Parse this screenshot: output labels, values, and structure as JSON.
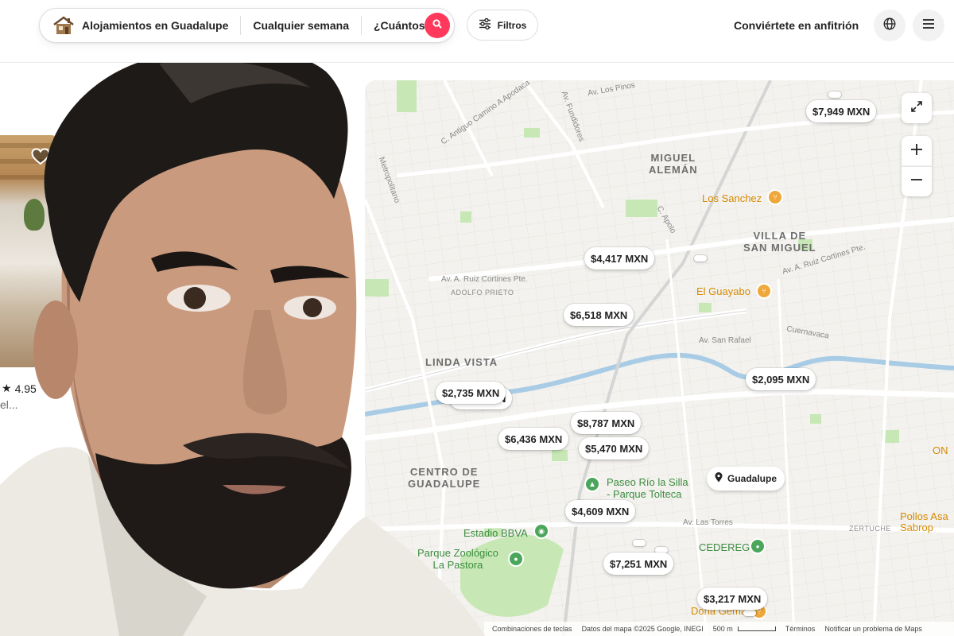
{
  "header": {
    "search": {
      "location": "Alojamientos en Guadalupe",
      "dates": "Cualquier semana",
      "guests": "¿Cuántos?"
    },
    "filters_label": "Filtros",
    "host_label": "Conviértete en anfitrión",
    "icons": {
      "logo": "house-icon",
      "search": "search-icon",
      "filters": "sliders-icon",
      "globe": "globe-icon",
      "menu": "hamburger-icon"
    }
  },
  "listing": {
    "rating": "4.95",
    "description": "el..."
  },
  "map": {
    "areas": [
      {
        "id": "miguel-aleman",
        "text": "MIGUEL\nALEMÁN"
      },
      {
        "id": "villa-de-san-miguel",
        "text": "VILLA DE\nSAN MIGUEL"
      },
      {
        "id": "linda-vista",
        "text": "LINDA VISTA"
      },
      {
        "id": "centro-de-guadalupe",
        "text": "CENTRO DE\nGUADALUPE"
      }
    ],
    "small_labels": {
      "adolfo_prieto": "ADOLFO PRIETO",
      "zertuche": "ZERTUCHE"
    },
    "streets": {
      "los_pinos": "Av. Los Pinos",
      "fundidores": "Av. Fundidores",
      "camino_apodaca": "C. Antiguo Camino A Apodaca",
      "ruiz_cortines_1": "Av. A. Ruiz Cortines Pte.",
      "ruiz_cortines_2": "Av. A. Ruiz Cortines Pte.",
      "apolo": "C. Apolo",
      "san_rafael": "Av. San Rafael",
      "cuernavaca": "Cuernavaca",
      "las_torres": "Av. Las Torres",
      "metropolitano": "Metropolitano"
    },
    "pois": {
      "los_sanchez": "Los Sanchez",
      "el_guayabo": "El Guayabo",
      "paseo_rio": "Paseo Río la Silla\n- Parque Tolteca",
      "estadio": "Estadio BBVA",
      "zoologico": "Parque Zoológico\nLa Pastora",
      "cedereg": "CEDEREG",
      "pollos": "Pollos Asa\nSabrop",
      "dona_gema": "Doña Gema",
      "on": "ON"
    },
    "guadalupe_pin": "Guadalupe",
    "prices": [
      {
        "id": "p1",
        "label": "$7,949 MXN"
      },
      {
        "id": "p2",
        "label": "$4,417 MXN"
      },
      {
        "id": "p3",
        "label": "$6,518 MXN"
      },
      {
        "id": "p4",
        "label": "$2,095 MXN"
      },
      {
        "id": "p5",
        "label": "$2,735 MXN"
      },
      {
        "id": "p6",
        "label": "$8,787 MXN"
      },
      {
        "id": "p7",
        "label": "$6,436 MXN"
      },
      {
        "id": "p8",
        "label": "$5,470 MXN"
      },
      {
        "id": "p9",
        "label": "$4,609 MXN"
      },
      {
        "id": "p10",
        "label": "$7,251 MXN"
      },
      {
        "id": "p11",
        "label": "$3,217 MXN"
      }
    ],
    "hidden_pin_fragment": "N",
    "footer": {
      "shortcuts": "Combinaciones de teclas",
      "map_data": "Datos del mapa ©2025 Google, INEGI",
      "scale": "500 m",
      "terms": "Términos",
      "report": "Notificar un problema de Maps"
    },
    "controls": {
      "expand": "expand-icon",
      "zoom_in": "plus-icon",
      "zoom_out": "minus-icon"
    }
  },
  "colors": {
    "brand": "#ff385c",
    "map_bg": "#f3f2ee",
    "park": "#c7e8b5",
    "river": "#a8cce5",
    "poi_orange": "#d68a00",
    "poi_green": "#3c8d40"
  }
}
